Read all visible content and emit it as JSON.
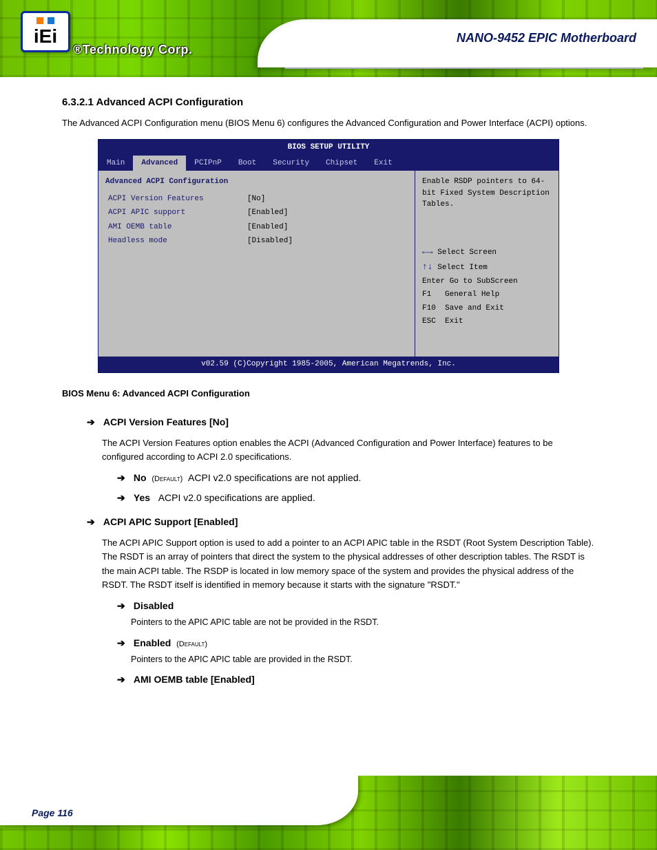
{
  "header": {
    "brand_reg": "®",
    "brand": "Technology Corp.",
    "logo_text": "iEi",
    "title": "NANO-9452 EPIC Motherboard"
  },
  "bios": {
    "utility_line": "BIOS SETUP UTILITY",
    "tabs": [
      "Main",
      "Advanced",
      "PCIPnP",
      "Boot",
      "Security",
      "Chipset",
      "Exit"
    ],
    "active_tab": "Advanced",
    "section_hdr": "Advanced ACPI Configuration",
    "rows": [
      {
        "k": "ACPI Version Features",
        "v": "[No]"
      },
      {
        "k": "ACPI APIC support",
        "v": "[Enabled]"
      },
      {
        "k": "AMI OEMB table",
        "v": "[Enabled]"
      },
      {
        "k": "Headless mode",
        "v": "[Disabled]"
      }
    ],
    "hint": "Enable RSDP pointers to 64-bit Fixed System Description Tables.",
    "keys": [
      {
        "glyph": "←→",
        "label": "Select Screen"
      },
      {
        "glyph": "↑↓",
        "label": "Select Item"
      },
      {
        "glyph": "Enter",
        "label": "Go to SubScreen"
      },
      {
        "glyph": "F1",
        "label": "General Help"
      },
      {
        "glyph": "F10",
        "label": "Save and Exit"
      },
      {
        "glyph": "ESC",
        "label": "Exit"
      }
    ],
    "copyright": "v02.59 (C)Copyright 1985-2005, American Megatrends, Inc."
  },
  "caption_prefix": "BIOS Menu 6:",
  "caption_rest": " Advanced ACPI Configuration",
  "pretext_title": "6.3.2.1 Advanced ACPI Configuration",
  "pretext_sub": "The Advanced ACPI Configuration menu (BIOS Menu 6) configures the Advanced Configuration and Power Interface (ACPI) options.",
  "options": [
    {
      "name": "ACPI Version Features [No]",
      "desc": "The ACPI Version Features option enables the ACPI (Advanced Configuration and Power Interface) features to be configured according to ACPI 2.0 specifications.",
      "subs": [
        {
          "label": "No",
          "default_tag": "(Default)",
          "text": "ACPI v2.0 specifications are not applied."
        },
        {
          "label": "Yes",
          "text": "ACPI v2.0 specifications are applied."
        }
      ]
    },
    {
      "name": "ACPI APIC Support [Enabled]",
      "desc": "The ACPI APIC Support option is used to add a pointer to an ACPI APIC table in the RSDT (Root System Description Table). The RSDT is an array of pointers that direct the system to the physical addresses of other description tables. The RSDT is the main ACPI table. The RSDP is located in low memory space of the system and provides the physical address of the RSDT. The RSDT itself is identified in memory because it starts with the signature \"RSDT.\"",
      "subs": [
        {
          "label": "Disabled",
          "text": "Pointers to the APIC APIC table are not be provided in the RSDT."
        },
        {
          "label": "Enabled",
          "default_tag": "(Default)",
          "text": "Pointers to the APIC APIC table are provided in the RSDT."
        },
        {
          "label": "AMI OEMB table [Enabled]",
          "is_header": true
        }
      ]
    }
  ],
  "page_number": "Page 116"
}
